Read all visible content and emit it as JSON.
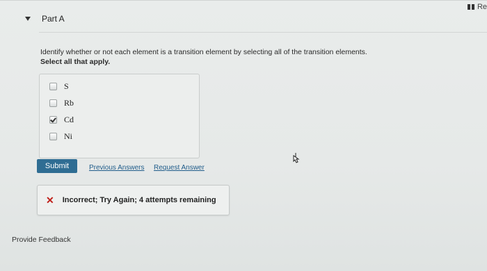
{
  "top_right": {
    "label": "Re",
    "icon": "bar-chart-icon"
  },
  "part": {
    "title": "Part A",
    "expanded": true
  },
  "question": {
    "prompt": "Identify whether or not each element is a transition element by selecting all of the transition elements.",
    "instruction": "Select all that apply."
  },
  "options": [
    {
      "label": "S",
      "checked": false
    },
    {
      "label": "Rb",
      "checked": false
    },
    {
      "label": "Cd",
      "checked": true
    },
    {
      "label": "Ni",
      "checked": false
    }
  ],
  "actions": {
    "submit_label": "Submit",
    "previous_answers_label": "Previous Answers",
    "request_answer_label": "Request Answer"
  },
  "feedback": {
    "icon": "x-icon",
    "message": "Incorrect; Try Again; 4 attempts remaining",
    "status_color": "#c0211b"
  },
  "footer": {
    "provide_feedback_label": "Provide Feedback"
  },
  "colors": {
    "accent": "#2f6d93",
    "link": "#1f5c8a"
  }
}
